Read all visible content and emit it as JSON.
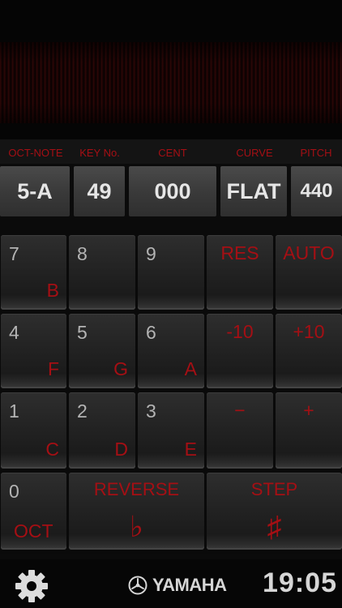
{
  "header": {
    "labels": [
      "OCT-NOTE",
      "KEY No.",
      "CENT",
      "CURVE",
      "PITCH"
    ],
    "values": [
      "5-A",
      "49",
      "000",
      "FLAT",
      "440"
    ]
  },
  "keys": {
    "k7": {
      "num": "7",
      "note": "B"
    },
    "k8": {
      "num": "8"
    },
    "k9": {
      "num": "9"
    },
    "res": "RES",
    "auto": "AUTO",
    "k4": {
      "num": "4",
      "note": "F"
    },
    "k5": {
      "num": "5",
      "note": "G"
    },
    "k6": {
      "num": "6",
      "note": "A"
    },
    "minus10": "-10",
    "plus10": "+10",
    "k1": {
      "num": "1",
      "note": "C"
    },
    "k2": {
      "num": "2",
      "note": "D"
    },
    "k3": {
      "num": "3",
      "note": "E"
    },
    "minus": "−",
    "plus": "+",
    "k0": {
      "num": "0",
      "label": "OCT"
    },
    "reverse": {
      "label": "REVERSE",
      "symbol": "♭"
    },
    "step": {
      "label": "STEP",
      "symbol": "♯"
    }
  },
  "footer": {
    "brand": "YAMAHA",
    "time": "19:05",
    "settings_icon": "gear-icon",
    "brand_icon": "yamaha-logo-icon"
  },
  "colors": {
    "accent": "#a50f14",
    "text": "#e6e6e6"
  }
}
